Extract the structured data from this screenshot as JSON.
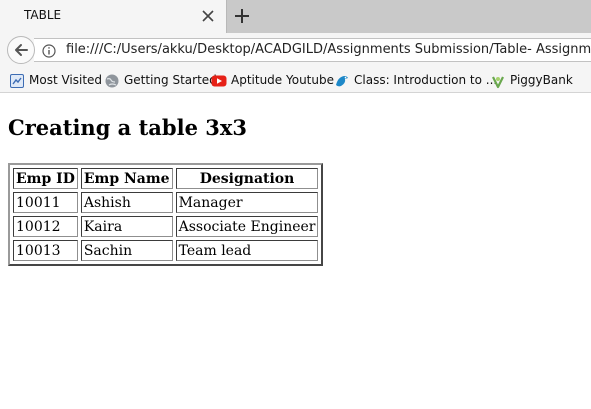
{
  "tab": {
    "title": "TABLE"
  },
  "navigation": {
    "url": "file:///C:/Users/akku/Desktop/ACADGILD/Assignments Submission/Table- Assignment"
  },
  "bookmarks": [
    {
      "label": "Most Visited",
      "icon": "most-visited-icon"
    },
    {
      "label": "Getting Started",
      "icon": "globe-icon"
    },
    {
      "label": "Aptitude Youtube",
      "icon": "youtube-icon"
    },
    {
      "label": "Class: Introduction to ...",
      "icon": "bird-icon"
    },
    {
      "label": "PiggyBank",
      "icon": "piggybank-icon"
    }
  ],
  "page": {
    "heading": "Creating a table 3x3",
    "table": {
      "headers": [
        "Emp ID",
        "Emp Name",
        "Designation"
      ],
      "rows": [
        [
          "10011",
          "Ashish",
          "Manager"
        ],
        [
          "10012",
          "Kaira",
          "Associate Engineer"
        ],
        [
          "10013",
          "Sachin",
          "Team lead"
        ]
      ]
    }
  },
  "colors": {
    "tab_strip": "#c9c9c9",
    "toolbar": "#f5f5f5",
    "youtube_red": "#e62117",
    "bird_blue": "#1e88c8",
    "piggy_green": "#6aa84f"
  }
}
